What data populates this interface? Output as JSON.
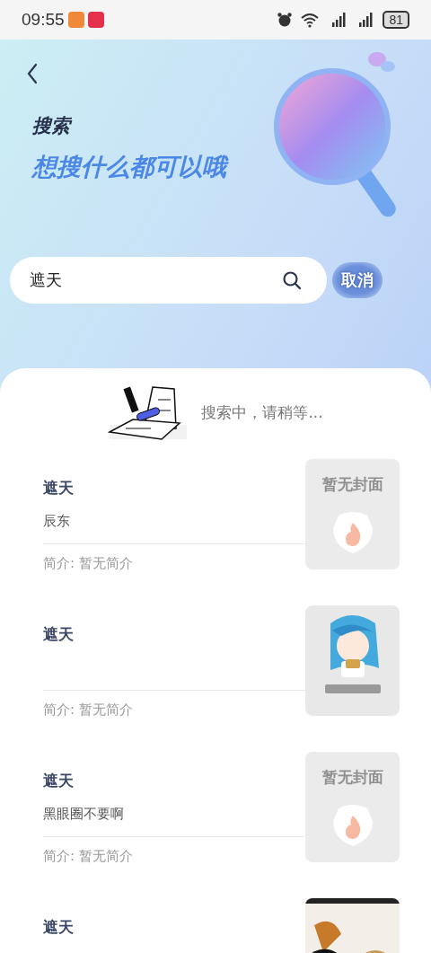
{
  "status_bar": {
    "time": "09:55",
    "battery": "81"
  },
  "header": {
    "title": "搜索",
    "slogan": "想搜什么都可以哦"
  },
  "search": {
    "value": "遮天",
    "cancel": "取消"
  },
  "loading": {
    "text": "搜索中，请稍等..."
  },
  "results": [
    {
      "title": "遮天",
      "author": "辰东",
      "intro": "简介: 暂无简介",
      "cover": {
        "kind": "placeholder",
        "text": "暂无封面"
      }
    },
    {
      "title": "遮天",
      "intro": "简介: 暂无简介"
    },
    {
      "title": "遮天",
      "author": "黑眼圈不要啊",
      "intro": "简介: 暂无简介",
      "cover": {
        "kind": "placeholder",
        "text": "暂无封面"
      }
    },
    {
      "title": "遮天"
    }
  ]
}
